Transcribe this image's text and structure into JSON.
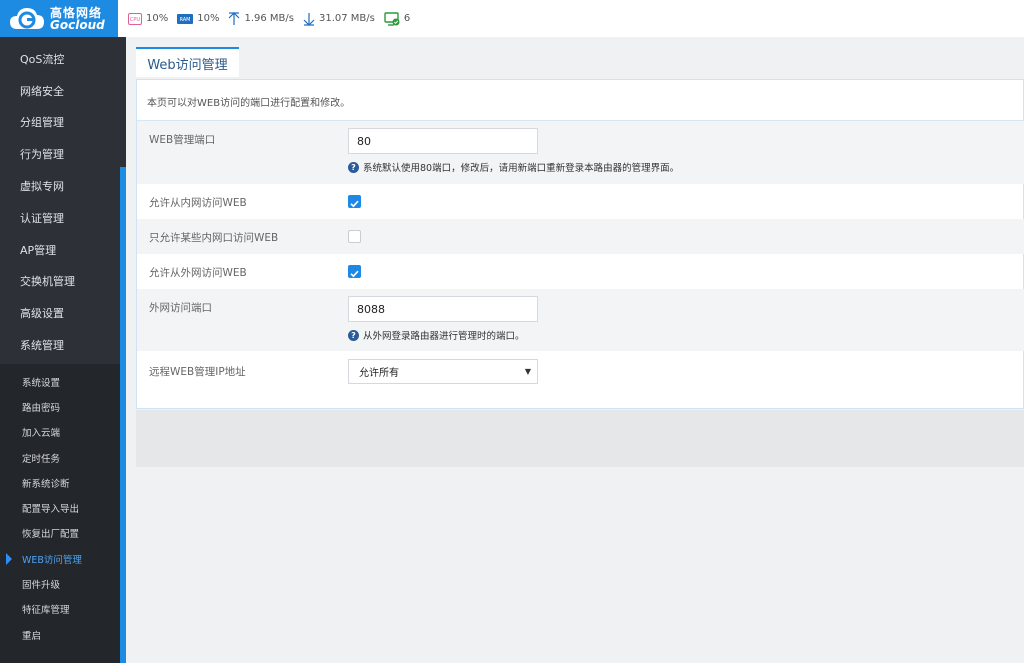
{
  "brand": {
    "name_cn": "高恪网络",
    "name_en": "Gocloud"
  },
  "status": {
    "cpu_label": "CPU",
    "cpu": "10%",
    "ram_label": "RAM",
    "ram": "10%",
    "upload": "1.96 MB/s",
    "download": "31.07 MB/s",
    "devices": "6"
  },
  "sidebar": {
    "items": [
      "QoS流控",
      "网络安全",
      "分组管理",
      "行为管理",
      "虚拟专网",
      "认证管理",
      "AP管理",
      "交换机管理",
      "高级设置",
      "系统管理"
    ],
    "subitems": [
      "系统设置",
      "路由密码",
      "加入云端",
      "定时任务",
      "新系统诊断",
      "配置导入导出",
      "恢复出厂配置",
      "WEB访问管理",
      "固件升级",
      "特征库管理",
      "重启"
    ]
  },
  "page": {
    "tab": "Web访问管理",
    "description": "本页可以对WEB访问的端口进行配置和修改。",
    "web_port_label": "WEB管理端口",
    "web_port_value": "80",
    "web_port_hint": "系统默认使用80端口，修改后，请用新端口重新登录本路由器的管理界面。",
    "allow_lan_label": "允许从内网访问WEB",
    "allow_lan_checked": true,
    "allow_some_lan_label": "只允许某些内网口访问WEB",
    "allow_some_lan_checked": false,
    "allow_wan_label": "允许从外网访问WEB",
    "allow_wan_checked": true,
    "wan_port_label": "外网访问端口",
    "wan_port_value": "8088",
    "wan_port_hint": "从外网登录路由器进行管理时的端口。",
    "remote_ip_label": "远程WEB管理IP地址",
    "remote_ip_value": "允许所有"
  },
  "colors": {
    "accent": "#1e8be3",
    "sidebar_bg": "#2d3036",
    "check": "#1e88e5"
  }
}
